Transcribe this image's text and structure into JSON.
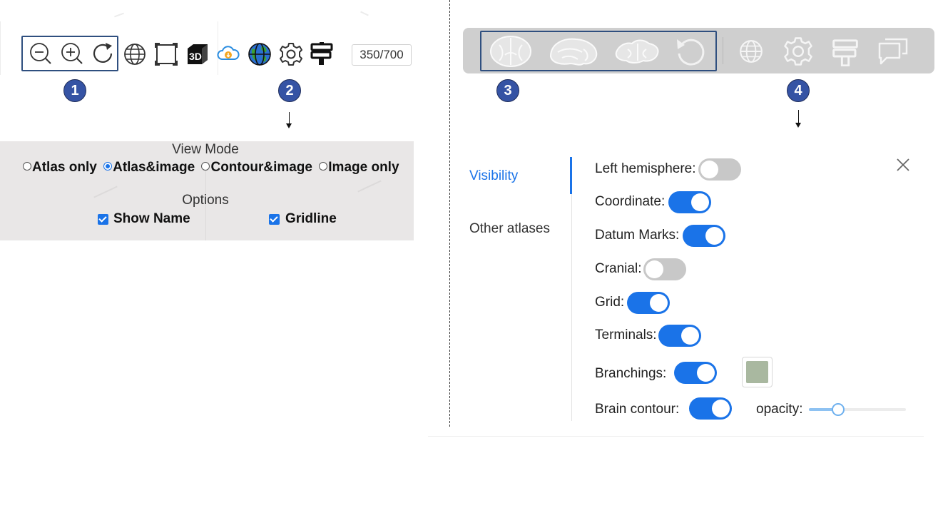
{
  "left_toolbar": {
    "counter": "350/700",
    "icons": [
      "zoom-out-icon",
      "zoom-in-icon",
      "reset-icon",
      "globe-icon",
      "fit-frame-icon",
      "3d-icon",
      "cloud-download-icon",
      "earth-icon",
      "gear-icon",
      "signpost-icon"
    ]
  },
  "badges": {
    "b1": "1",
    "b2": "2",
    "b3": "3",
    "b4": "4"
  },
  "view_panel": {
    "view_mode_title": "View Mode",
    "modes": [
      "Atlas only",
      "Atlas&image",
      "Contour&image",
      "Image only"
    ],
    "selected_mode": "Atlas&image",
    "options_title": "Options",
    "show_name_label": "Show Name",
    "show_name_checked": true,
    "gridline_label": "Gridline",
    "gridline_checked": true
  },
  "right_toolbar": {
    "icons": [
      "coronal-slice-icon",
      "sagittal-slice-icon",
      "horizontal-slice-icon",
      "rotate-icon",
      "globe-icon",
      "gear-icon",
      "signpost-icon",
      "chat-icon"
    ]
  },
  "settings": {
    "tabs": [
      "Visibility",
      "Other atlases"
    ],
    "active_tab": "Visibility",
    "items": [
      {
        "label": "Left hemisphere:",
        "on": false
      },
      {
        "label": "Coordinate:",
        "on": true
      },
      {
        "label": "Datum Marks:",
        "on": true
      },
      {
        "label": "Cranial:",
        "on": false
      },
      {
        "label": "Grid:",
        "on": true
      },
      {
        "label": "Terminals:",
        "on": true
      },
      {
        "label": "Branchings:",
        "on": true
      },
      {
        "label": "Brain contour:",
        "on": true
      }
    ],
    "branching_color": "#a9b8a0",
    "opacity_label": "opacity:",
    "opacity_value": 0.3
  },
  "colors": {
    "accent": "#1a73e8",
    "badge": "#3553a4",
    "panel_bg": "#e9e7e7",
    "toolbar_bg": "#cfcfcf"
  }
}
